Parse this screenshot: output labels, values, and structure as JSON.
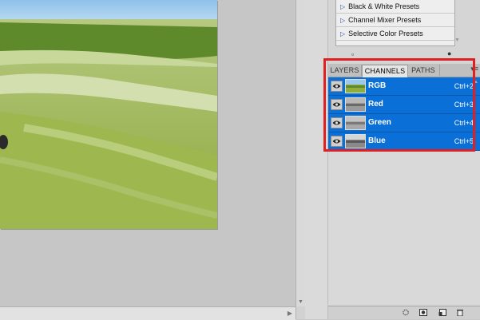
{
  "presets": {
    "items": [
      {
        "label": "Black & White Presets"
      },
      {
        "label": "Channel Mixer Presets"
      },
      {
        "label": "Selective Color Presets"
      }
    ]
  },
  "channels_panel": {
    "tabs": [
      {
        "label": "LAYERS",
        "active": false
      },
      {
        "label": "CHANNELS",
        "active": true
      },
      {
        "label": "PATHS",
        "active": false
      }
    ],
    "channels": [
      {
        "name": "RGB",
        "shortcut": "Ctrl+2",
        "visible": true,
        "selected": true
      },
      {
        "name": "Red",
        "shortcut": "Ctrl+3",
        "visible": true,
        "selected": true
      },
      {
        "name": "Green",
        "shortcut": "Ctrl+4",
        "visible": true,
        "selected": true
      },
      {
        "name": "Blue",
        "shortcut": "Ctrl+5",
        "visible": true,
        "selected": true
      }
    ]
  },
  "colors": {
    "selection_blue": "#0a6fd6",
    "highlight_red": "#e02020",
    "grass_green": "#8fae3a",
    "sky_blue": "#9cc8ea"
  },
  "icons": {
    "preset_triangle": "triangle-right-icon",
    "channel_visibility": "eye-icon",
    "panel_menu": "panel-menu-icon"
  }
}
